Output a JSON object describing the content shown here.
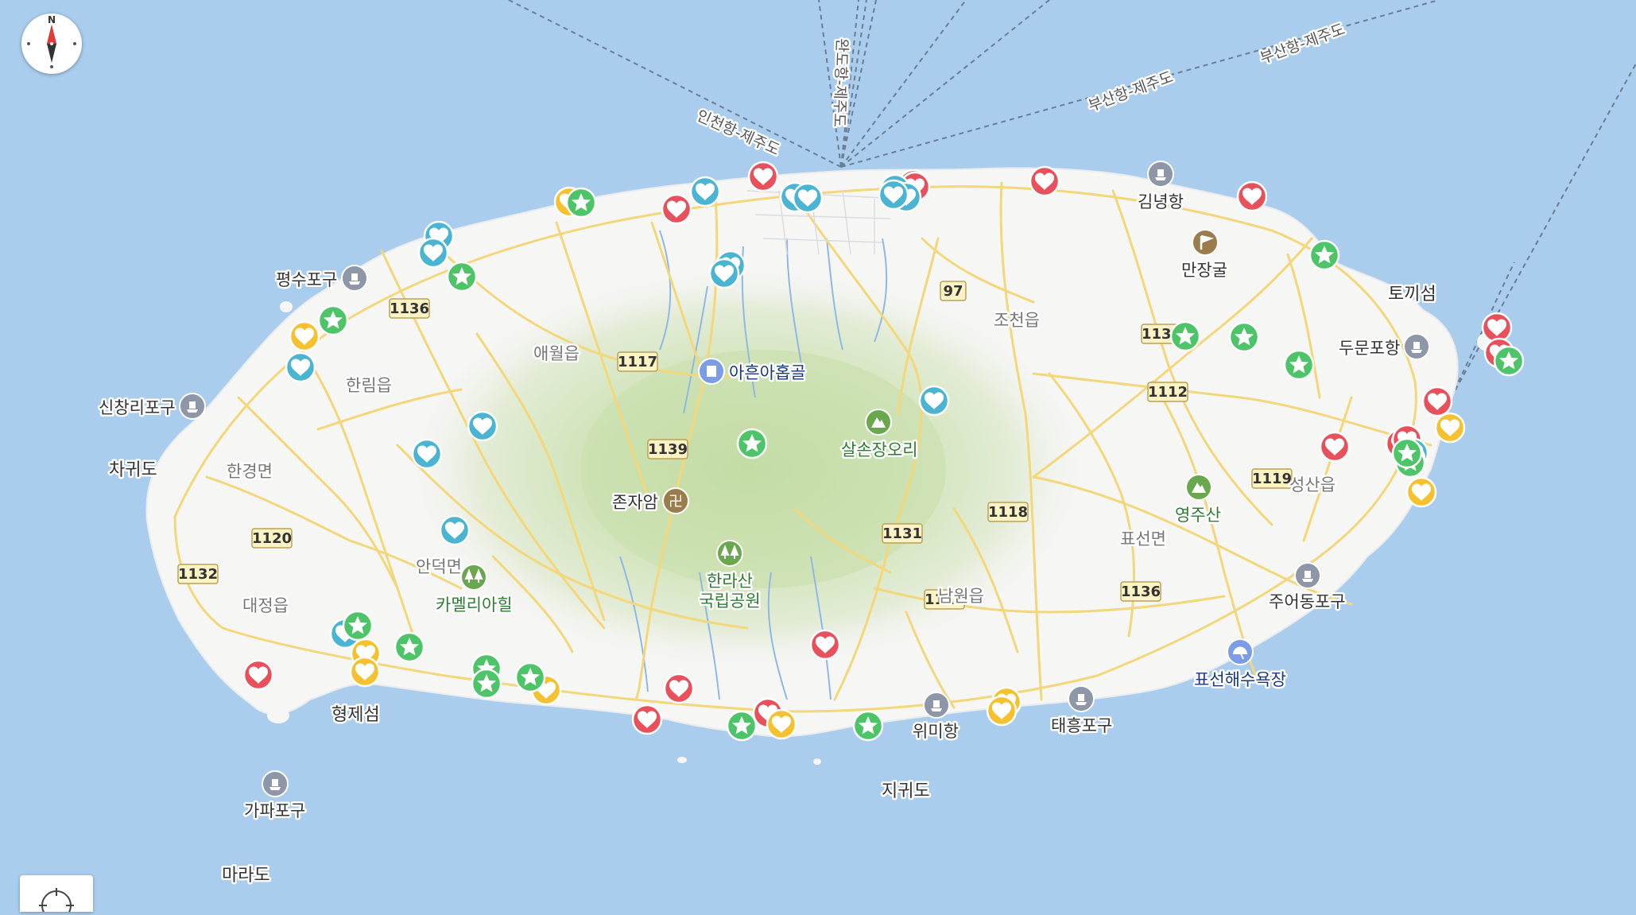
{
  "map": {
    "compass": {
      "north_label": "N"
    },
    "ferry_routes": [
      {
        "label": "인천항-제주도"
      },
      {
        "label": "완도항-제주도"
      },
      {
        "label": "부산항-제주도"
      },
      {
        "label": "부산항-제주도"
      }
    ],
    "road_shields": [
      "1136",
      "1117",
      "97",
      "1136",
      "1112",
      "1139",
      "1131",
      "1118",
      "1119",
      "1119",
      "1120",
      "1132",
      "1136"
    ],
    "regions": [
      "애월읍",
      "한림읍",
      "한경면",
      "조천읍",
      "표선면",
      "성산읍",
      "대정읍",
      "안덕면",
      "남원읍"
    ],
    "islands": [
      "차귀도",
      "토끼섬",
      "형제섬",
      "지귀도",
      "마라도"
    ],
    "places": [
      {
        "name": "평수포구",
        "kind": "port"
      },
      {
        "name": "신창리포구",
        "kind": "port"
      },
      {
        "name": "김녕항",
        "kind": "port"
      },
      {
        "name": "만장굴",
        "kind": "landmark"
      },
      {
        "name": "두문포항",
        "kind": "port"
      },
      {
        "name": "아흔아홉골",
        "kind": "hall"
      },
      {
        "name": "살손장오리",
        "kind": "mountain"
      },
      {
        "name": "존자암",
        "kind": "temple"
      },
      {
        "name": "영주산",
        "kind": "mountain"
      },
      {
        "name": "한라산 국립공원",
        "kind": "park"
      },
      {
        "name": "카멜리아힐",
        "kind": "park"
      },
      {
        "name": "주어동포구",
        "kind": "port"
      },
      {
        "name": "표선해수욕장",
        "kind": "beach"
      },
      {
        "name": "위미항",
        "kind": "port"
      },
      {
        "name": "태흥포구",
        "kind": "port"
      },
      {
        "name": "가파포구",
        "kind": "port"
      }
    ],
    "colors": {
      "sea": "#aacdee",
      "land": "#f6f6f4",
      "road": "#f3d77a",
      "marker_red": "#e8505b",
      "marker_teal": "#4ab4d3",
      "marker_yellow": "#f5c12e",
      "marker_green": "#4cc467"
    },
    "markers": [
      {
        "type": "red"
      },
      {
        "type": "red"
      },
      {
        "type": "red"
      },
      {
        "type": "red"
      },
      {
        "type": "red"
      },
      {
        "type": "red"
      },
      {
        "type": "red"
      },
      {
        "type": "red"
      },
      {
        "type": "red"
      },
      {
        "type": "red"
      },
      {
        "type": "red"
      },
      {
        "type": "red"
      },
      {
        "type": "red"
      },
      {
        "type": "red"
      },
      {
        "type": "red"
      },
      {
        "type": "red"
      },
      {
        "type": "red"
      },
      {
        "type": "teal"
      },
      {
        "type": "teal"
      },
      {
        "type": "teal"
      },
      {
        "type": "teal"
      },
      {
        "type": "teal"
      },
      {
        "type": "teal"
      },
      {
        "type": "teal"
      },
      {
        "type": "teal"
      },
      {
        "type": "teal"
      },
      {
        "type": "teal"
      },
      {
        "type": "teal"
      },
      {
        "type": "teal"
      },
      {
        "type": "teal"
      },
      {
        "type": "teal"
      },
      {
        "type": "teal"
      },
      {
        "type": "teal"
      },
      {
        "type": "teal"
      },
      {
        "type": "teal"
      },
      {
        "type": "yellow"
      },
      {
        "type": "yellow"
      },
      {
        "type": "yellow"
      },
      {
        "type": "yellow"
      },
      {
        "type": "yellow"
      },
      {
        "type": "yellow"
      },
      {
        "type": "yellow"
      },
      {
        "type": "yellow"
      },
      {
        "type": "yellow"
      },
      {
        "type": "yellow"
      },
      {
        "type": "green"
      },
      {
        "type": "green"
      },
      {
        "type": "green"
      },
      {
        "type": "green"
      },
      {
        "type": "green"
      },
      {
        "type": "green"
      },
      {
        "type": "green"
      },
      {
        "type": "green"
      },
      {
        "type": "green"
      },
      {
        "type": "green"
      },
      {
        "type": "green"
      },
      {
        "type": "green"
      },
      {
        "type": "green"
      },
      {
        "type": "green"
      },
      {
        "type": "green"
      },
      {
        "type": "green"
      },
      {
        "type": "green"
      },
      {
        "type": "green"
      }
    ]
  }
}
